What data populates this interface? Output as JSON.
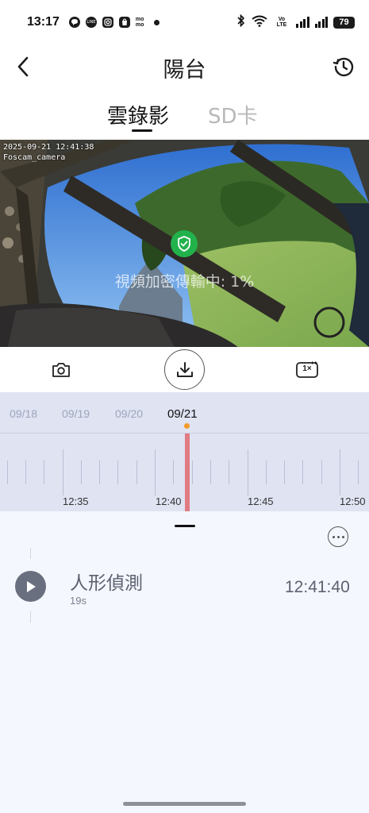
{
  "status_bar": {
    "time": "13:17",
    "left_icons": [
      "speech-bubble-icon",
      "line-app-icon",
      "instagram-icon",
      "shopee-icon",
      "momo-icon",
      "notification-dot-icon"
    ],
    "momo_label": "mo mo",
    "line_label": "LINE",
    "network_label": "Vo LTE",
    "battery": "79"
  },
  "header": {
    "title": "陽台",
    "back_icon": "chevron-left-icon",
    "history_icon": "history-clock-icon"
  },
  "tabs": [
    {
      "label": "雲錄影",
      "active": true
    },
    {
      "label": "SD卡",
      "active": false
    }
  ],
  "video": {
    "timestamp": "2025-09-21 12:41:38",
    "camera_name": "Foscam_camera",
    "status_text": "視頻加密傳輸中: 1%",
    "shield_color": "#22b24c"
  },
  "controls": {
    "snapshot_icon": "camera-icon",
    "download_icon": "download-icon",
    "speed_icon": "playback-speed-icon",
    "speed_label": "1×"
  },
  "timeline": {
    "dates": [
      "09/18",
      "09/19",
      "09/20",
      "09/21"
    ],
    "selected_date": "09/21",
    "time_labels": [
      "12:35",
      "12:40",
      "12:45",
      "12:50"
    ],
    "marker_color": "#f29b2b",
    "playhead_color": "#e07a83"
  },
  "events": [
    {
      "type": "人形偵測",
      "duration": "19s",
      "time": "12:41:40",
      "icon": "play-icon"
    }
  ]
}
